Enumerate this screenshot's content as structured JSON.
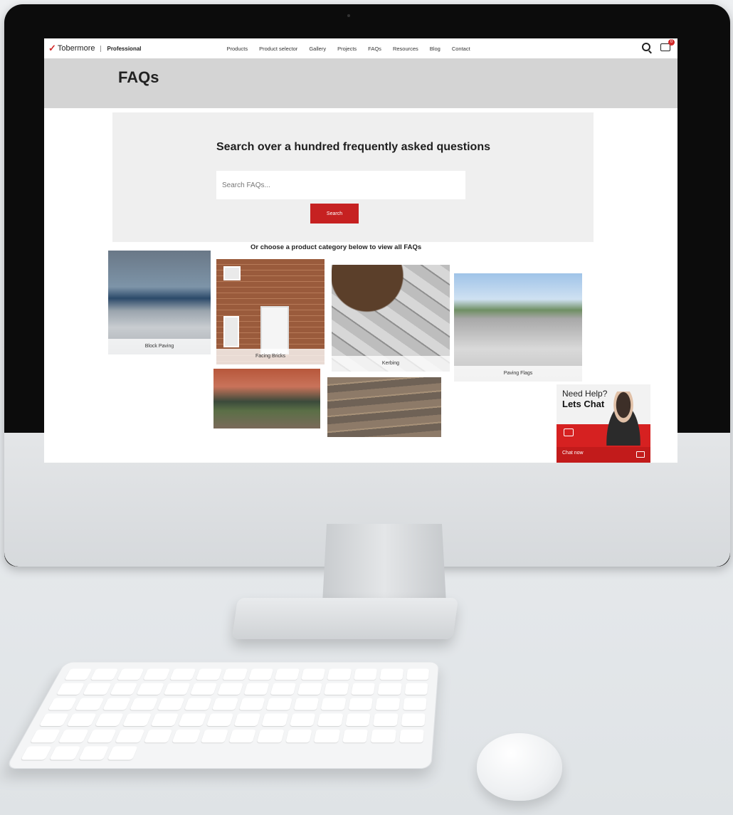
{
  "site": {
    "brand": "Tobermore",
    "brand_sub": "Professional",
    "cart_count": "0"
  },
  "nav": {
    "items": [
      "Products",
      "Product selector",
      "Gallery",
      "Projects",
      "FAQs",
      "Resources",
      "Blog",
      "Contact"
    ]
  },
  "page": {
    "title": "FAQs"
  },
  "search": {
    "heading": "Search over a hundred frequently asked questions",
    "placeholder": "Search FAQs...",
    "button_label": "Search"
  },
  "categories": {
    "heading": "Or choose a product category below to view all FAQs",
    "items": [
      "Block Paving",
      "Facing Bricks",
      "Kerbing",
      "Paving Flags"
    ]
  },
  "chat": {
    "line1": "Need Help?",
    "line2": "Lets Chat",
    "button_label": "Chat now"
  },
  "colors": {
    "accent": "#c62121",
    "header_band": "#d4d4d4"
  }
}
